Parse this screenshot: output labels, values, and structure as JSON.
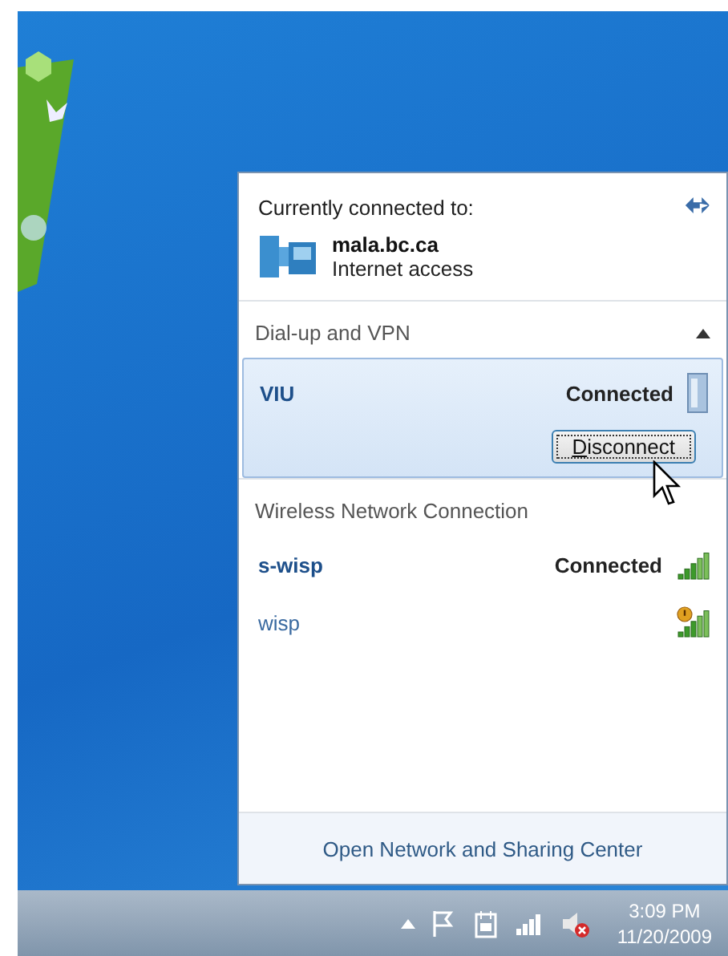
{
  "current": {
    "heading": "Currently connected to:",
    "network": "mala.bc.ca",
    "access": "Internet access"
  },
  "sections": [
    {
      "title": "Dial-up and VPN",
      "expanded": true,
      "connections": [
        {
          "name": "VIU",
          "status": "Connected",
          "kind": "vpn",
          "selected": true,
          "button": "Disconnect"
        }
      ]
    },
    {
      "title": "Wireless Network Connection",
      "connections": [
        {
          "name": "s-wisp",
          "status": "Connected",
          "kind": "wifi",
          "selected": false
        },
        {
          "name": "wisp",
          "kind": "wifi-unsecured",
          "selected": false
        }
      ]
    }
  ],
  "footer_link": "Open Network and Sharing Center",
  "taskbar": {
    "time": "3:09 PM",
    "date": "11/20/2009"
  }
}
